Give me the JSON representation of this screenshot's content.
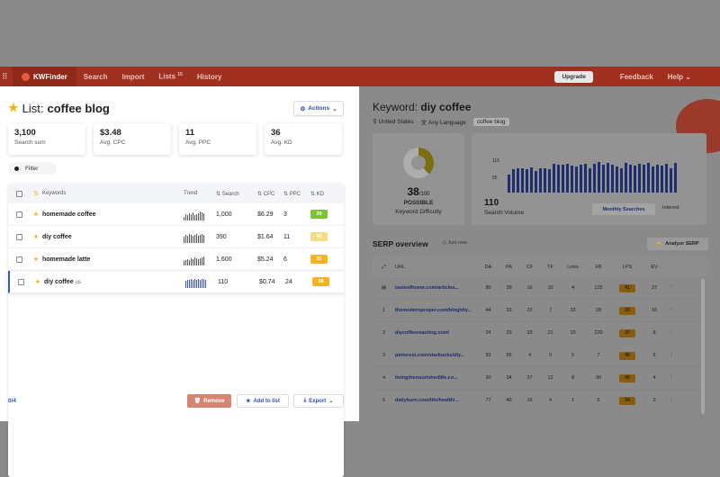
{
  "topnav": {
    "brand": "KWFinder",
    "items": [
      "Search",
      "Import",
      "Lists",
      "History"
    ],
    "lists_badge": "15",
    "upgrade": "Upgrade",
    "feedback": "Feedback",
    "help": "Help"
  },
  "left": {
    "list_prefix": "List:",
    "list_name": "coffee blog",
    "actions_label": "Actions",
    "stats": [
      {
        "value": "3,100",
        "label": "Search sum"
      },
      {
        "value": "$3.48",
        "label": "Avg. CPC"
      },
      {
        "value": "11",
        "label": "Avg. PPC"
      },
      {
        "value": "36",
        "label": "Avg. KD"
      }
    ],
    "filter_label": "Filter",
    "columns": {
      "keywords": "Keywords",
      "trend": "Trend",
      "search": "Search",
      "cpc": "CPC",
      "ppc": "PPC",
      "kd": "KD"
    },
    "rows": [
      {
        "keyword": "homemade coffee",
        "loc": "",
        "search": "1,000",
        "cpc": "$6.29",
        "ppc": "3",
        "kd": "29",
        "kd_color": "#7cc531",
        "trend": [
          4,
          6,
          5,
          7,
          6,
          8,
          5,
          6,
          7,
          9,
          8,
          7
        ],
        "active": false
      },
      {
        "keyword": "diy coffee",
        "loc": "",
        "search": "390",
        "cpc": "$1.64",
        "ppc": "11",
        "kd": "40",
        "kd_color": "#f3dc86",
        "trend": [
          6,
          8,
          7,
          9,
          8,
          7,
          8,
          9,
          7,
          8,
          9,
          8
        ],
        "active": false
      },
      {
        "keyword": "homemade latte",
        "loc": "",
        "search": "1,600",
        "cpc": "$5.24",
        "ppc": "6",
        "kd": "32",
        "kd_color": "#f4b21e",
        "trend": [
          5,
          6,
          7,
          6,
          8,
          7,
          9,
          8,
          7,
          8,
          9,
          10
        ],
        "active": false
      },
      {
        "keyword": "diy coffee",
        "loc": "us",
        "search": "110",
        "cpc": "$0.74",
        "ppc": "24",
        "kd": "38",
        "kd_color": "#f4b21e",
        "trend": [
          7,
          8,
          8,
          9,
          8,
          9,
          8,
          9,
          8,
          9,
          9,
          8
        ],
        "active": true
      }
    ],
    "selection_count": "0/4",
    "remove_label": "Remove",
    "add_to_list_label": "Add to list",
    "export_label": "Export"
  },
  "right": {
    "keyword_prefix": "Keyword:",
    "keyword": "diy coffee",
    "location": "United States",
    "language": "Any Language",
    "tag": "coffee blog",
    "kd_value": "38",
    "kd_max": "/100",
    "kd_fraction": 0.38,
    "kd_word": "POSSIBLE",
    "kd_caption": "Keyword Difficulty",
    "sv_ticks": [
      "115",
      "55"
    ],
    "sv_bars": [
      60,
      75,
      78,
      80,
      75,
      82,
      70,
      78,
      80,
      76,
      95,
      92,
      90,
      95,
      88,
      85,
      92,
      94,
      80,
      95,
      100,
      90,
      96,
      92,
      85,
      78,
      98,
      92,
      88,
      95,
      90,
      96,
      85,
      92,
      88,
      94,
      78,
      96
    ],
    "sv_value": "110",
    "sv_caption": "Search Volume",
    "sv_tab_active": "Monthly Searches",
    "sv_tab_other": "Interest",
    "serp_title": "SERP overview",
    "serp_time": "Just now",
    "analyze_label": "Analyze SERP",
    "serp_columns": [
      "URL",
      "DA",
      "PA",
      "CF",
      "TF",
      "Links",
      "FB",
      "LPS",
      "EV"
    ],
    "serp_rows": [
      {
        "rank": "",
        "url": "tasteofhome.com/articles...",
        "da": "80",
        "pa": "39",
        "cf": "16",
        "tf": "10",
        "links": "4",
        "fb": "125",
        "lps": "41",
        "ev": "37"
      },
      {
        "rank": "1",
        "url": "themodernproper.com/blog/diy...",
        "da": "44",
        "pa": "33",
        "cf": "22",
        "tf": "7",
        "links": "33",
        "fb": "28",
        "lps": "33",
        "ev": "16"
      },
      {
        "rank": "2",
        "url": "diycoffeeroasting.com/",
        "da": "24",
        "pa": "29",
        "cf": "33",
        "tf": "21",
        "links": "10",
        "fb": "220",
        "lps": "37",
        "ev": "8"
      },
      {
        "rank": "3",
        "url": "pinterest.com/starbucks/diy...",
        "da": "93",
        "pa": "55",
        "cf": "4",
        "tf": "0",
        "links": "5",
        "fb": "7",
        "lps": "40",
        "ev": "6"
      },
      {
        "rank": "4",
        "url": "livingthenourishedlife.co...",
        "da": "30",
        "pa": "34",
        "cf": "27",
        "tf": "12",
        "links": "8",
        "fb": "90",
        "lps": "40",
        "ev": "4"
      },
      {
        "rank": "5",
        "url": "dailyburn.com/life/health/...",
        "da": "77",
        "pa": "40",
        "cf": "16",
        "tf": "4",
        "links": "1",
        "fb": "5",
        "lps": "34",
        "ev": "3"
      }
    ]
  }
}
